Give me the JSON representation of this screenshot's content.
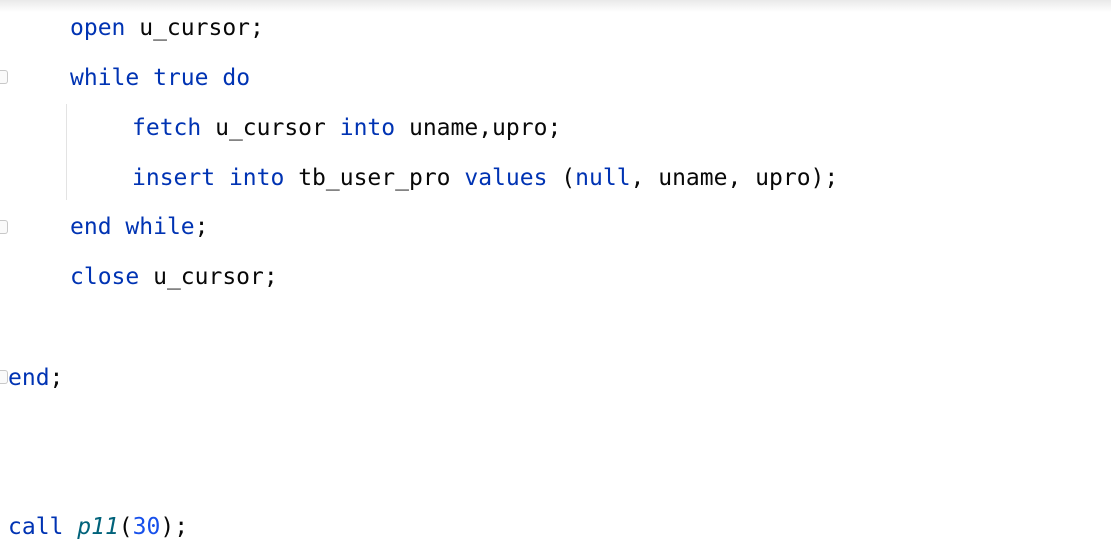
{
  "editor": {
    "lines": [
      {
        "tokens": [
          {
            "t": "open",
            "c": "kw"
          },
          {
            "t": " u_cursor;",
            "c": "id"
          }
        ]
      },
      {
        "tokens": [
          {
            "t": "while",
            "c": "kw"
          },
          {
            "t": " ",
            "c": "id"
          },
          {
            "t": "true",
            "c": "kw"
          },
          {
            "t": " ",
            "c": "id"
          },
          {
            "t": "do",
            "c": "kw"
          }
        ]
      },
      {
        "tokens": [
          {
            "t": "fetch",
            "c": "kw"
          },
          {
            "t": " u_cursor ",
            "c": "id"
          },
          {
            "t": "into",
            "c": "kw"
          },
          {
            "t": " uname,upro;",
            "c": "id"
          }
        ]
      },
      {
        "tokens": [
          {
            "t": "insert",
            "c": "kw"
          },
          {
            "t": " ",
            "c": "id"
          },
          {
            "t": "into",
            "c": "kw"
          },
          {
            "t": " tb_user_pro ",
            "c": "id"
          },
          {
            "t": "values",
            "c": "kw"
          },
          {
            "t": " (",
            "c": "id"
          },
          {
            "t": "null",
            "c": "kw"
          },
          {
            "t": ", uname, upro);",
            "c": "id"
          }
        ]
      },
      {
        "tokens": [
          {
            "t": "end",
            "c": "kw"
          },
          {
            "t": " ",
            "c": "id"
          },
          {
            "t": "while",
            "c": "kw"
          },
          {
            "t": ";",
            "c": "id"
          }
        ]
      },
      {
        "tokens": [
          {
            "t": "close",
            "c": "kw"
          },
          {
            "t": " u_cursor;",
            "c": "id"
          }
        ]
      },
      {
        "tokens": [
          {
            "t": "end",
            "c": "kw"
          },
          {
            "t": ";",
            "c": "id"
          }
        ]
      },
      {
        "tokens": [
          {
            "t": "call",
            "c": "kw"
          },
          {
            "t": " ",
            "c": "id"
          },
          {
            "t": "p11",
            "c": "fn"
          },
          {
            "t": "(",
            "c": "id"
          },
          {
            "t": "30",
            "c": "num"
          },
          {
            "t": ");",
            "c": "id"
          }
        ]
      }
    ]
  }
}
